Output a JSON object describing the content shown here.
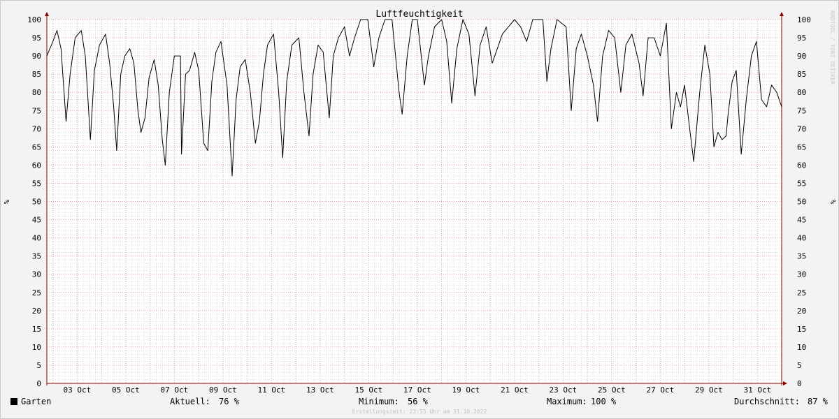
{
  "chart_data": {
    "type": "line",
    "title": "Luftfeuchtigkeit",
    "ylabel": "%",
    "ylim": [
      0,
      100
    ],
    "y_ticks": [
      0,
      5,
      10,
      15,
      20,
      25,
      30,
      35,
      40,
      45,
      50,
      55,
      60,
      65,
      70,
      75,
      80,
      85,
      90,
      95,
      100
    ],
    "x_start": "2022-10-01T18:00",
    "x_end": "2022-10-31T23:55",
    "x_ticks": [
      "03 Oct",
      "05 Oct",
      "07 Oct",
      "09 Oct",
      "11 Oct",
      "13 Oct",
      "15 Oct",
      "17 Oct",
      "19 Oct",
      "21 Oct",
      "23 Oct",
      "25 Oct",
      "27 Oct",
      "29 Oct",
      "31 Oct"
    ],
    "x_tick_dates": [
      "2022-10-03T00:00",
      "2022-10-05T00:00",
      "2022-10-07T00:00",
      "2022-10-09T00:00",
      "2022-10-11T00:00",
      "2022-10-13T00:00",
      "2022-10-15T00:00",
      "2022-10-17T00:00",
      "2022-10-19T00:00",
      "2022-10-21T00:00",
      "2022-10-23T00:00",
      "2022-10-25T00:00",
      "2022-10-27T00:00",
      "2022-10-29T00:00",
      "2022-10-31T00:00"
    ],
    "grid": true,
    "series": [
      {
        "name": "Garten",
        "color": "#000000",
        "points": [
          [
            "2022-10-01T18:00",
            90
          ],
          [
            "2022-10-02T00:00",
            94
          ],
          [
            "2022-10-02T04:00",
            97
          ],
          [
            "2022-10-02T08:00",
            92
          ],
          [
            "2022-10-02T13:00",
            72
          ],
          [
            "2022-10-02T17:00",
            85
          ],
          [
            "2022-10-02T22:00",
            95
          ],
          [
            "2022-10-03T04:00",
            97
          ],
          [
            "2022-10-03T08:00",
            90
          ],
          [
            "2022-10-03T13:00",
            67
          ],
          [
            "2022-10-03T17:00",
            86
          ],
          [
            "2022-10-03T22:00",
            93
          ],
          [
            "2022-10-04T04:00",
            96
          ],
          [
            "2022-10-04T08:00",
            88
          ],
          [
            "2022-10-04T12:00",
            76
          ],
          [
            "2022-10-04T15:00",
            64
          ],
          [
            "2022-10-04T19:00",
            85
          ],
          [
            "2022-10-04T23:00",
            90
          ],
          [
            "2022-10-05T04:00",
            92
          ],
          [
            "2022-10-05T08:00",
            88
          ],
          [
            "2022-10-05T12:00",
            75
          ],
          [
            "2022-10-05T15:00",
            69
          ],
          [
            "2022-10-05T19:00",
            73
          ],
          [
            "2022-10-05T23:00",
            84
          ],
          [
            "2022-10-06T04:00",
            89
          ],
          [
            "2022-10-06T08:00",
            82
          ],
          [
            "2022-10-06T12:00",
            67
          ],
          [
            "2022-10-06T15:00",
            60
          ],
          [
            "2022-10-06T19:00",
            80
          ],
          [
            "2022-10-07T00:00",
            90
          ],
          [
            "2022-10-07T06:00",
            90
          ],
          [
            "2022-10-07T07:00",
            63
          ],
          [
            "2022-10-07T11:00",
            85
          ],
          [
            "2022-10-07T15:00",
            86
          ],
          [
            "2022-10-07T20:00",
            91
          ],
          [
            "2022-10-08T00:00",
            86
          ],
          [
            "2022-10-08T05:00",
            66
          ],
          [
            "2022-10-08T09:00",
            64
          ],
          [
            "2022-10-08T13:00",
            83
          ],
          [
            "2022-10-08T17:00",
            91
          ],
          [
            "2022-10-08T22:00",
            94
          ],
          [
            "2022-10-09T04:00",
            82
          ],
          [
            "2022-10-09T09:00",
            57
          ],
          [
            "2022-10-09T13:00",
            78
          ],
          [
            "2022-10-09T17:00",
            87
          ],
          [
            "2022-10-09T22:00",
            89
          ],
          [
            "2022-10-10T03:00",
            80
          ],
          [
            "2022-10-10T08:00",
            66
          ],
          [
            "2022-10-10T12:00",
            72
          ],
          [
            "2022-10-10T16:00",
            85
          ],
          [
            "2022-10-10T20:00",
            93
          ],
          [
            "2022-10-11T02:00",
            96
          ],
          [
            "2022-10-11T07:00",
            80
          ],
          [
            "2022-10-11T11:00",
            62
          ],
          [
            "2022-10-11T15:00",
            83
          ],
          [
            "2022-10-11T20:00",
            93
          ],
          [
            "2022-10-12T03:00",
            95
          ],
          [
            "2022-10-12T08:00",
            80
          ],
          [
            "2022-10-12T13:00",
            68
          ],
          [
            "2022-10-12T17:00",
            85
          ],
          [
            "2022-10-12T22:00",
            93
          ],
          [
            "2022-10-13T03:00",
            91
          ],
          [
            "2022-10-13T09:00",
            73
          ],
          [
            "2022-10-13T13:00",
            90
          ],
          [
            "2022-10-13T18:00",
            95
          ],
          [
            "2022-10-14T00:00",
            98
          ],
          [
            "2022-10-14T05:00",
            90
          ],
          [
            "2022-10-14T10:00",
            95
          ],
          [
            "2022-10-14T16:00",
            100
          ],
          [
            "2022-10-14T23:00",
            100
          ],
          [
            "2022-10-15T05:00",
            87
          ],
          [
            "2022-10-15T10:00",
            95
          ],
          [
            "2022-10-15T16:00",
            100
          ],
          [
            "2022-10-15T23:00",
            100
          ],
          [
            "2022-10-16T06:00",
            80
          ],
          [
            "2022-10-16T09:00",
            74
          ],
          [
            "2022-10-16T14:00",
            90
          ],
          [
            "2022-10-16T19:00",
            100
          ],
          [
            "2022-10-17T00:00",
            100
          ],
          [
            "2022-10-17T07:00",
            82
          ],
          [
            "2022-10-17T11:00",
            90
          ],
          [
            "2022-10-17T17:00",
            98
          ],
          [
            "2022-10-18T00:00",
            100
          ],
          [
            "2022-10-18T05:00",
            94
          ],
          [
            "2022-10-18T10:00",
            77
          ],
          [
            "2022-10-18T15:00",
            92
          ],
          [
            "2022-10-18T21:00",
            100
          ],
          [
            "2022-10-19T03:00",
            96
          ],
          [
            "2022-10-19T09:00",
            79
          ],
          [
            "2022-10-19T14:00",
            93
          ],
          [
            "2022-10-19T20:00",
            98
          ],
          [
            "2022-10-20T02:00",
            88
          ],
          [
            "2022-10-20T07:00",
            92
          ],
          [
            "2022-10-20T12:00",
            96
          ],
          [
            "2022-10-20T18:00",
            98
          ],
          [
            "2022-10-21T00:00",
            100
          ],
          [
            "2022-10-21T06:00",
            98
          ],
          [
            "2022-10-21T12:00",
            94
          ],
          [
            "2022-10-21T18:00",
            100
          ],
          [
            "2022-10-22T04:00",
            100
          ],
          [
            "2022-10-22T08:00",
            83
          ],
          [
            "2022-10-22T12:00",
            92
          ],
          [
            "2022-10-22T18:00",
            100
          ],
          [
            "2022-10-23T03:00",
            98
          ],
          [
            "2022-10-23T08:00",
            75
          ],
          [
            "2022-10-23T13:00",
            92
          ],
          [
            "2022-10-23T18:00",
            96
          ],
          [
            "2022-10-24T00:00",
            90
          ],
          [
            "2022-10-24T06:00",
            82
          ],
          [
            "2022-10-24T10:00",
            72
          ],
          [
            "2022-10-24T15:00",
            90
          ],
          [
            "2022-10-24T21:00",
            97
          ],
          [
            "2022-10-25T03:00",
            95
          ],
          [
            "2022-10-25T09:00",
            80
          ],
          [
            "2022-10-25T14:00",
            93
          ],
          [
            "2022-10-25T20:00",
            96
          ],
          [
            "2022-10-26T03:00",
            88
          ],
          [
            "2022-10-26T07:00",
            79
          ],
          [
            "2022-10-26T12:00",
            95
          ],
          [
            "2022-10-26T18:00",
            95
          ],
          [
            "2022-10-27T00:00",
            90
          ],
          [
            "2022-10-27T06:00",
            99
          ],
          [
            "2022-10-27T11:00",
            70
          ],
          [
            "2022-10-27T16:00",
            80
          ],
          [
            "2022-10-27T20:00",
            76
          ],
          [
            "2022-10-28T00:00",
            82
          ],
          [
            "2022-10-28T05:00",
            70
          ],
          [
            "2022-10-28T09:00",
            61
          ],
          [
            "2022-10-28T15:00",
            80
          ],
          [
            "2022-10-28T20:00",
            93
          ],
          [
            "2022-10-29T01:00",
            85
          ],
          [
            "2022-10-29T05:00",
            65
          ],
          [
            "2022-10-29T09:00",
            69
          ],
          [
            "2022-10-29T13:00",
            67
          ],
          [
            "2022-10-29T17:00",
            68
          ],
          [
            "2022-10-29T19:00",
            74
          ],
          [
            "2022-10-29T23:00",
            83
          ],
          [
            "2022-10-30T03:00",
            86
          ],
          [
            "2022-10-30T08:00",
            63
          ],
          [
            "2022-10-30T13:00",
            78
          ],
          [
            "2022-10-30T18:00",
            90
          ],
          [
            "2022-10-30T23:00",
            94
          ],
          [
            "2022-10-31T04:00",
            78
          ],
          [
            "2022-10-31T09:00",
            76
          ],
          [
            "2022-10-31T14:00",
            82
          ],
          [
            "2022-10-31T19:00",
            80
          ],
          [
            "2022-10-31T23:55",
            76
          ]
        ]
      }
    ]
  },
  "legend": {
    "series_name": "Garten",
    "current_label": "Aktuell:",
    "current_value": "76 %",
    "min_label": "Minimum:",
    "min_value": "56 %",
    "max_label": "Maximum:",
    "max_value": "100 %",
    "avg_label": "Durchschnitt:",
    "avg_value": "87 %"
  },
  "footer": "Erstellungszeit: 23:55 Uhr am 31.10.2022",
  "side_brand": "RRDTOOL / TOBI OETIKER",
  "colors": {
    "major_grid": "#e0a0a0",
    "minor_grid": "#d8d8d8",
    "axis": "#8b0000",
    "line": "#000000"
  }
}
